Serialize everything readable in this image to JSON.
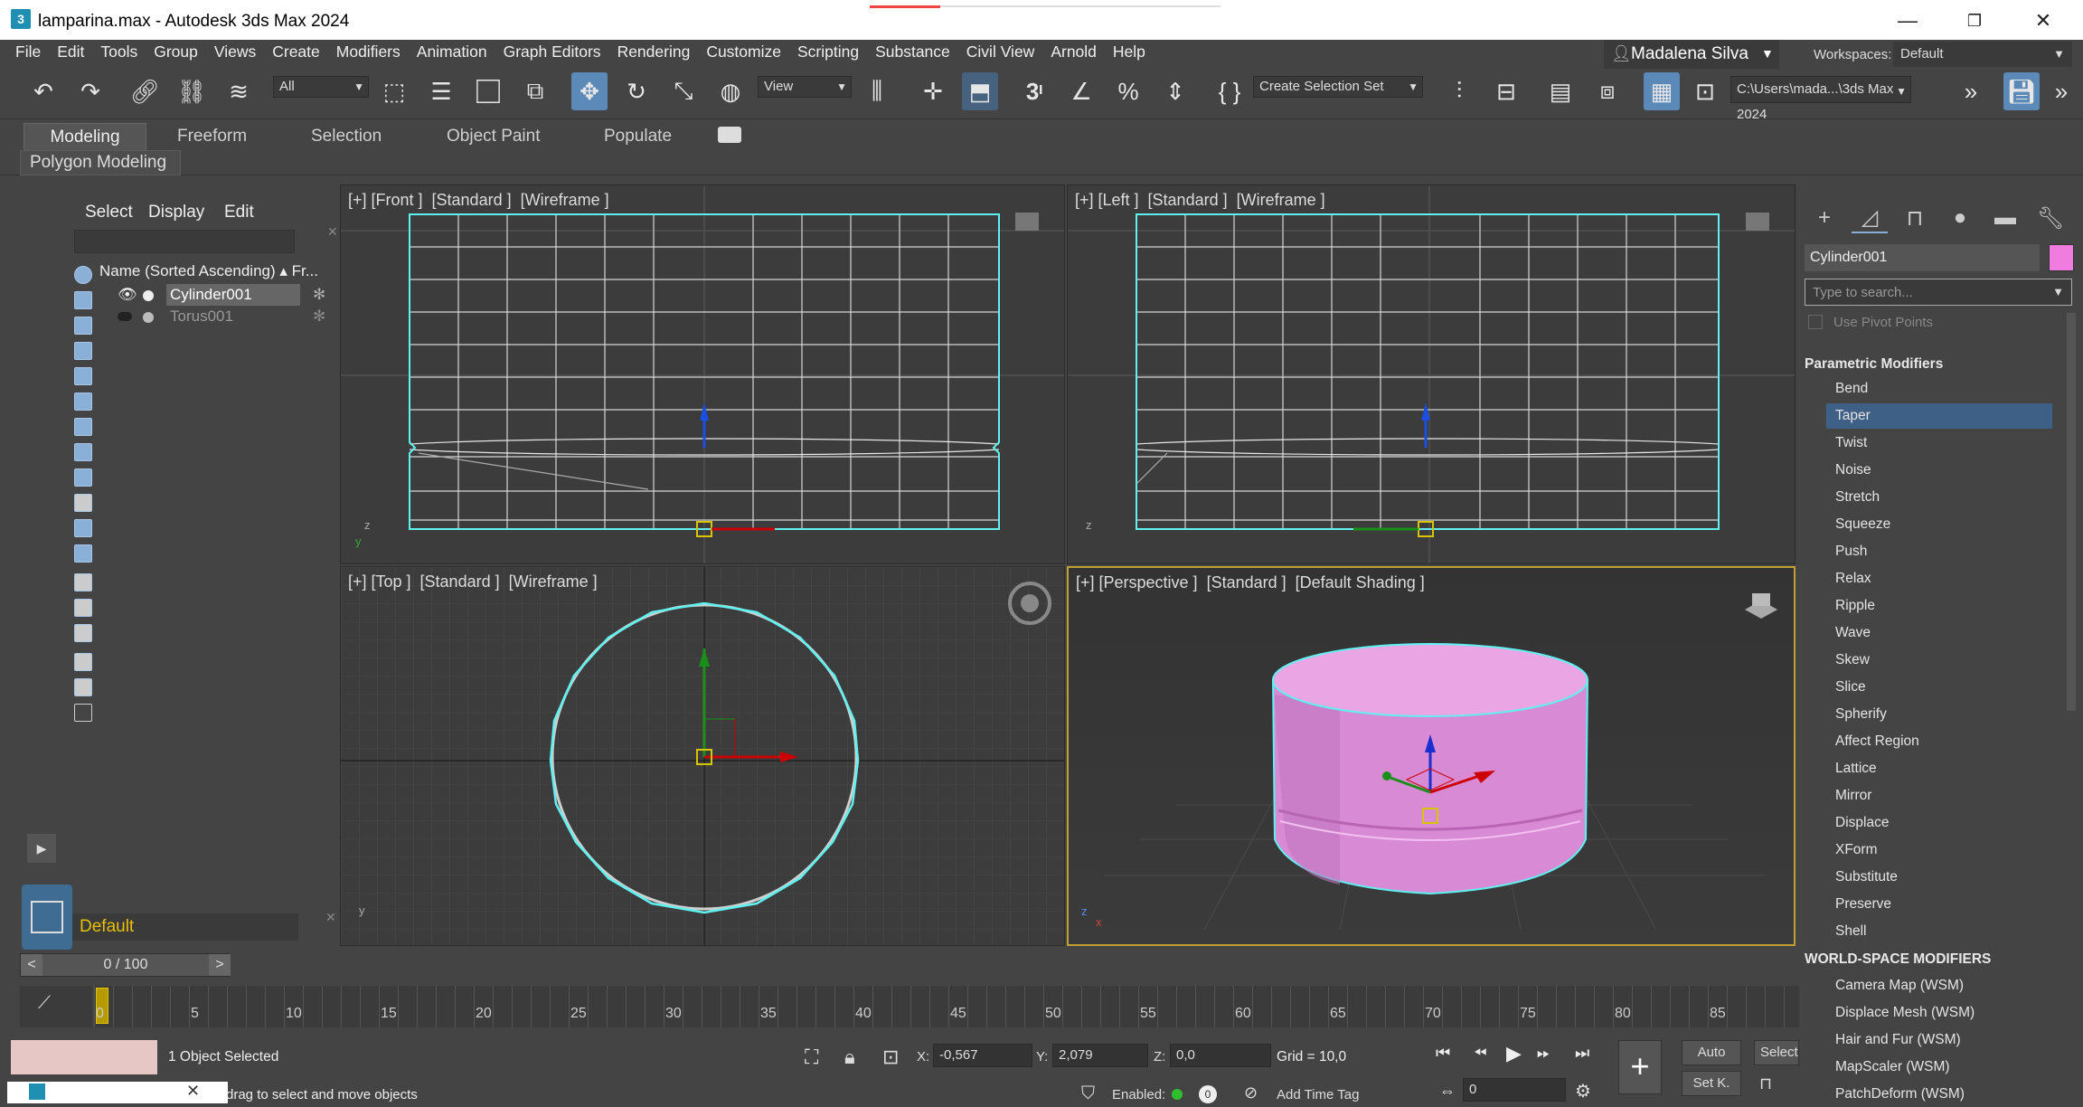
{
  "window": {
    "title": "lamparina.max - Autodesk 3ds Max 2024",
    "app_icon_label": "3",
    "minimize": "—",
    "restore": "❐",
    "close": "✕"
  },
  "menu": [
    "File",
    "Edit",
    "Tools",
    "Group",
    "Views",
    "Create",
    "Modifiers",
    "Animation",
    "Graph Editors",
    "Rendering",
    "Customize",
    "Scripting",
    "Substance",
    "Civil View",
    "Arnold",
    "Help"
  ],
  "account": {
    "user": "Madalena Silva",
    "workspaces_label": "Workspaces:",
    "workspace": "Default"
  },
  "toolbar": {
    "filter_value": "All",
    "refcoord_value": "View",
    "selection_set_placeholder": "Create Selection Set",
    "path_value": "C:\\Users\\mada...\\3ds Max 2024",
    "snap_label": "3",
    "more": "»"
  },
  "ribbon": {
    "tabs": [
      "Modeling",
      "Freeform",
      "Selection",
      "Object Paint",
      "Populate"
    ],
    "active_tab": "Modeling",
    "sub_label": "Polygon Modeling"
  },
  "explorer": {
    "tabs": [
      "Select",
      "Display",
      "Edit"
    ],
    "column_header": "Name (Sorted Ascending)",
    "column_header2": "▴ Fr...",
    "items": [
      {
        "name": "Cylinder001",
        "selected": true
      },
      {
        "name": "Torus001",
        "selected": false
      }
    ],
    "layer": "Default"
  },
  "viewports": {
    "front": "[+] [Front ]  [Standard ]  [Wireframe ]",
    "left": "[+] [Left ]  [Standard ]  [Wireframe ]",
    "top": "[+] [Top ]  [Standard ]  [Wireframe ]",
    "persp": "[+] [Perspective ]  [Standard ]  [Default Shading ]",
    "axis_x": "x",
    "axis_y": "y",
    "axis_z": "z"
  },
  "command_panel": {
    "object_name": "Cylinder001",
    "object_color": "#f07ce0",
    "search_placeholder": "Type to search...",
    "use_pivot": "Use Pivot Points",
    "parametric_heading": "Parametric Modifiers",
    "parametric": [
      "Bend",
      "Taper",
      "Twist",
      "Noise",
      "Stretch",
      "Squeeze",
      "Push",
      "Relax",
      "Ripple",
      "Wave",
      "Skew",
      "Slice",
      "Spherify",
      "Affect Region",
      "Lattice",
      "Mirror",
      "Displace",
      "XForm",
      "Substitute",
      "Preserve",
      "Shell"
    ],
    "selected_modifier": "Taper",
    "wsm_heading": "WORLD-SPACE MODIFIERS",
    "wsm": [
      "Camera Map (WSM)",
      "Displace Mesh (WSM)",
      "Hair and Fur (WSM)",
      "MapScaler (WSM)",
      "PatchDeform (WSM)"
    ]
  },
  "timeline": {
    "frame_display": "0 / 100",
    "prev": "<",
    "next": ">",
    "ticks": [
      "0",
      "5",
      "10",
      "15",
      "20",
      "25",
      "30",
      "35",
      "40",
      "45",
      "50",
      "55",
      "60",
      "65",
      "70",
      "75",
      "80",
      "85"
    ]
  },
  "status": {
    "selection": "1 Object Selected",
    "prompt": "drag to select and move objects",
    "x_label": "X:",
    "x_value": "-0,567",
    "y_label": "Y:",
    "y_value": "2,079",
    "z_label": "Z:",
    "z_value": "0,0",
    "grid": "Grid = 10,0",
    "enabled_label": "Enabled:",
    "add_time_tag": "Add Time Tag",
    "auto": "Auto",
    "set_key": "Set K.",
    "selected_filter": "Selecte",
    "frame_field": "0"
  },
  "colors": {
    "accent": "#5b89b8",
    "selection_cyan": "#5ff1f0",
    "object_pink": "#e79ae0"
  }
}
